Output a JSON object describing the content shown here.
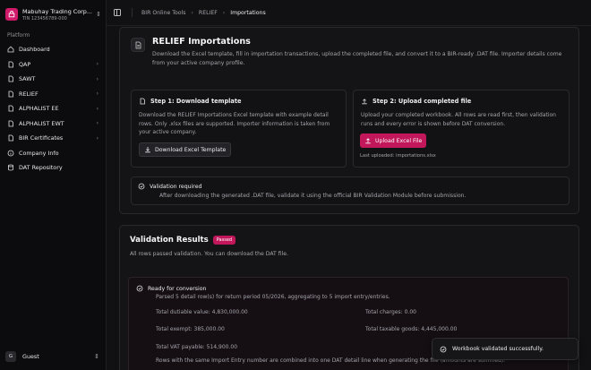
{
  "sidebar": {
    "company_name": "Mabuhay Trading Corp...",
    "company_tin": "TIN 123456789-000",
    "section_label": "Platform",
    "items": [
      {
        "label": "Dashboard",
        "icon": "home-icon",
        "chevron": false
      },
      {
        "label": "QAP",
        "icon": "file-icon",
        "chevron": true
      },
      {
        "label": "SAWT",
        "icon": "file-icon",
        "chevron": true
      },
      {
        "label": "RELIEF",
        "icon": "file-icon",
        "chevron": true
      },
      {
        "label": "ALPHALIST EE",
        "icon": "file-icon",
        "chevron": true
      },
      {
        "label": "ALPHALIST EWT",
        "icon": "file-icon",
        "chevron": true
      },
      {
        "label": "BIR Certificates",
        "icon": "file-icon",
        "chevron": true
      },
      {
        "label": "Company Info",
        "icon": "info-icon",
        "chevron": false
      },
      {
        "label": "DAT Repository",
        "icon": "database-icon",
        "chevron": false
      }
    ],
    "user": {
      "initial": "G",
      "name": "Guest"
    }
  },
  "breadcrumb": [
    "BIR Online Tools",
    "RELIEF",
    "Importations"
  ],
  "header": {
    "title": "RELIEF Importations",
    "description": "Download the Excel template, fill in importation transactions, upload the completed file, and convert it to a BIR-ready .DAT file. Importer details come from your active company profile."
  },
  "step1": {
    "title": "Step 1: Download template",
    "description": "Download the RELIEF Importations Excel template with example detail rows. Only .xlsx files are supported. Importer information is taken from your active company.",
    "button": "Download Excel Template"
  },
  "step2": {
    "title": "Step 2: Upload completed file",
    "description": "Upload your completed workbook. All rows are read first, then validation runs and every error is shown before DAT conversion.",
    "button": "Upload Excel File",
    "last_uploaded": "Last uploaded: importations.xlsx"
  },
  "notice": {
    "title": "Validation required",
    "description": "After downloading the generated .DAT file, validate it using the official BIR Validation Module before submission."
  },
  "validation": {
    "title": "Validation Results",
    "badge": "Passed",
    "description": "All rows passed validation. You can download the DAT file.",
    "ready": {
      "title": "Ready for conversion",
      "description": "Parsed 5 detail row(s) for return period 05/2026, aggregating to 5 import entry/entries.",
      "total_dutiable": "Total dutiable value: 4,830,000.00",
      "total_charges": "Total charges: 0.00",
      "total_exempt": "Total exempt: 385,000.00",
      "total_taxable": "Total taxable goods: 4,445,000.00",
      "total_vat": "Total VAT payable: 514,900.00",
      "footnote": "Rows with the same Import Entry number are combined into one DAT detail line when generating the file (amounts are summed)."
    }
  },
  "toast": "Workbook validated successfully.",
  "colors": {
    "accent": "#c2185b",
    "brand": "#d11a6a",
    "background": "#111113"
  }
}
